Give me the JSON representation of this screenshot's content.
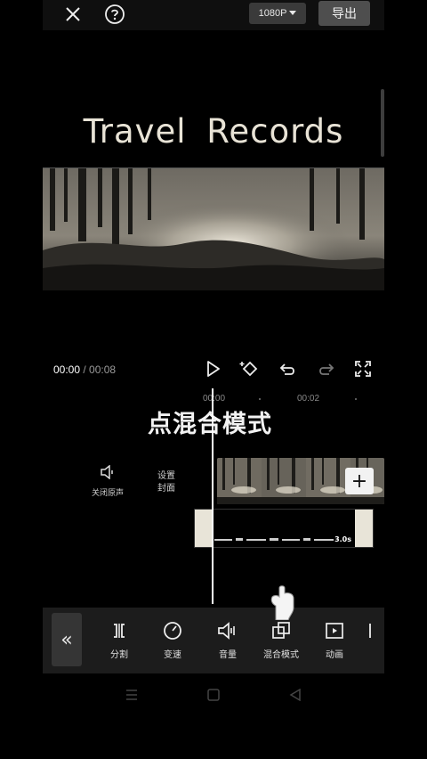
{
  "topbar": {
    "resolution": "1080P",
    "export_label": "导出"
  },
  "preview": {
    "title": "Travel  Records",
    "time_current": "00:00",
    "time_separator": " / ",
    "time_total": "00:08"
  },
  "timeline": {
    "ruler": [
      "00:00",
      "00:02"
    ],
    "overlay_caption": "点混合模式",
    "mute_label": "关闭原声",
    "cover_label_1": "设置",
    "cover_label_2": "封面",
    "audio_duration": "3.0s"
  },
  "toolbar": {
    "items": [
      {
        "label": "分割",
        "icon": "split-icon"
      },
      {
        "label": "变速",
        "icon": "speed-icon"
      },
      {
        "label": "音量",
        "icon": "volume-icon"
      },
      {
        "label": "混合模式",
        "icon": "blend-mode-icon"
      },
      {
        "label": "动画",
        "icon": "animation-icon"
      }
    ]
  },
  "colors": {
    "accent": "#e8e4d8",
    "toolbar_bg": "#1c1c1c",
    "button_bg": "#4e4e4e"
  }
}
